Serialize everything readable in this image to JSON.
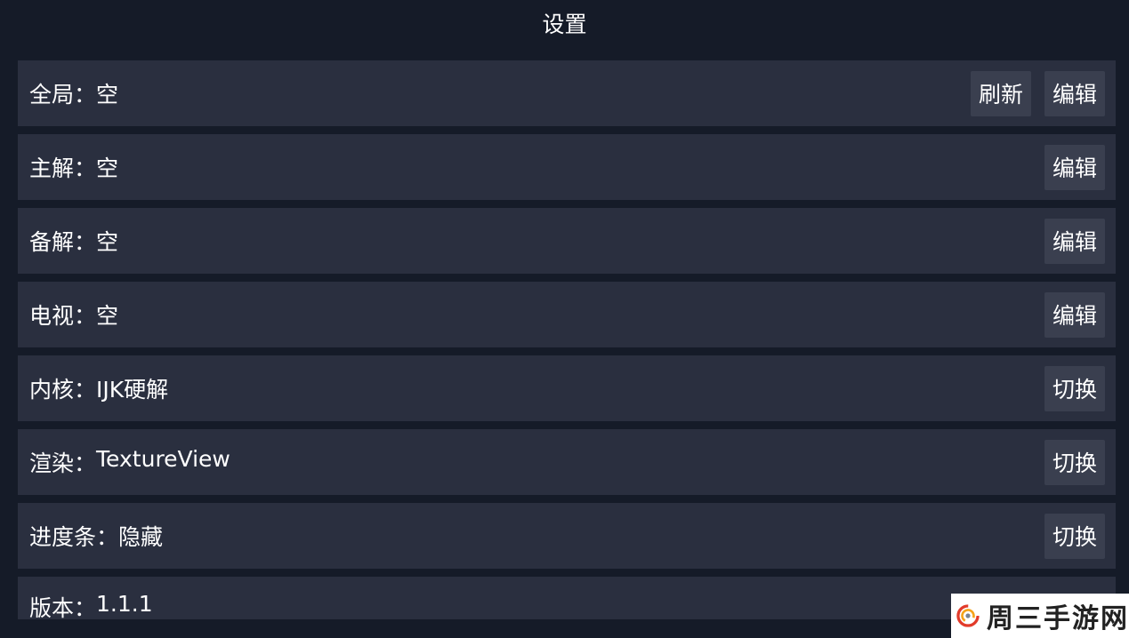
{
  "header": {
    "title": "设置"
  },
  "settings": [
    {
      "label": "全局",
      "separator": "：",
      "value": "空",
      "buttons": [
        "刷新",
        "编辑"
      ]
    },
    {
      "label": "主解",
      "separator": "：",
      "value": "空",
      "buttons": [
        "编辑"
      ]
    },
    {
      "label": "备解",
      "separator": "：",
      "value": "空",
      "buttons": [
        "编辑"
      ]
    },
    {
      "label": "电视",
      "separator": "：",
      "value": "空",
      "buttons": [
        "编辑"
      ]
    },
    {
      "label": "内核",
      "separator": "：",
      "value": "IJK硬解",
      "buttons": [
        "切换"
      ]
    },
    {
      "label": "渲染",
      "separator": "：",
      "value": "TextureView",
      "buttons": [
        "切换"
      ]
    },
    {
      "label": "进度条",
      "separator": "：",
      "value": "隐藏",
      "buttons": [
        "切换"
      ]
    },
    {
      "label": "版本",
      "separator": "：",
      "value": "1.1.1",
      "buttons": []
    }
  ],
  "watermark": {
    "text": "周三手游网",
    "logo_icon": "spiral-logo-icon",
    "logo_colors": [
      "#e23b2a",
      "#f5a31a",
      "#7a8390"
    ]
  },
  "colors": {
    "background": "#151b28",
    "row": "#2a2f3f",
    "button": "#3a3f4f",
    "text": "#ffffff"
  }
}
